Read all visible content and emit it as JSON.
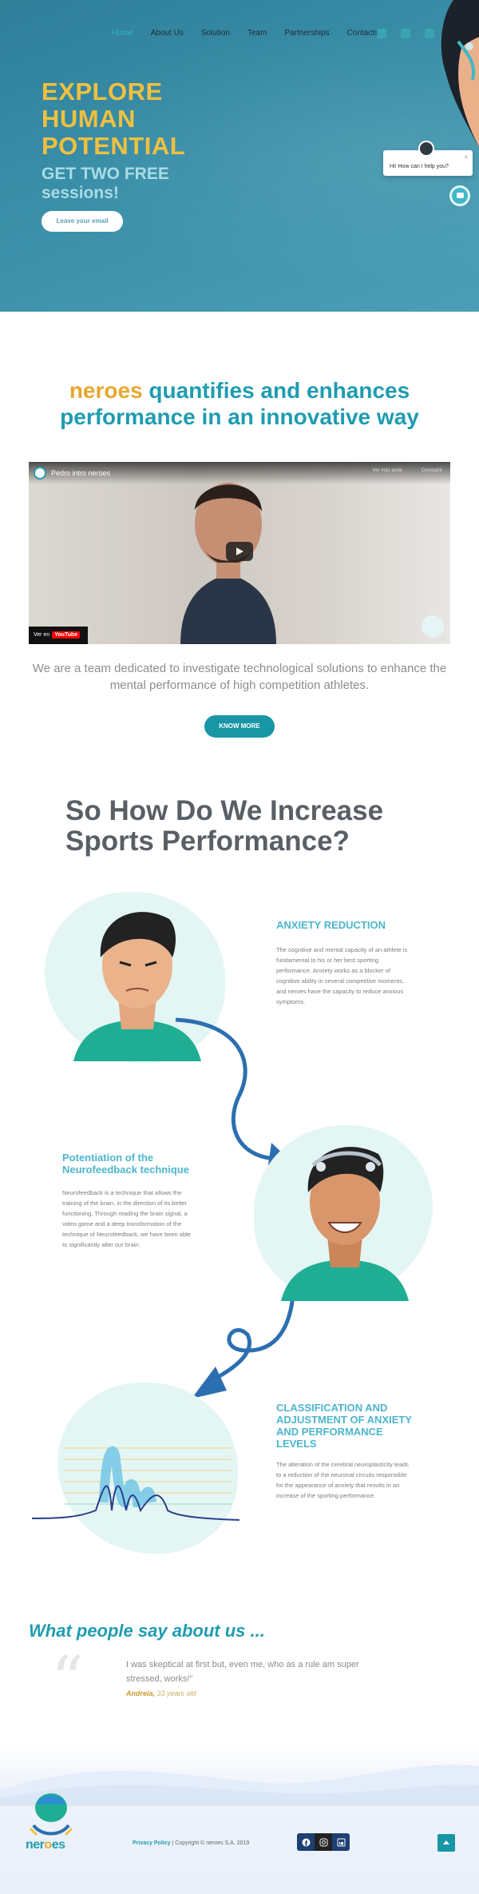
{
  "nav": {
    "items": [
      "Home",
      "About Us",
      "Solution",
      "Team",
      "Partnerships",
      "Contacts"
    ],
    "social_icons": [
      "facebook-icon",
      "instagram-icon",
      "linkedin-icon"
    ]
  },
  "hero": {
    "title": "EXPLORE HUMAN POTENTIAL",
    "subtitle": "GET TWO FREE sessions!",
    "email_button": "Leave your email"
  },
  "chat": {
    "greeting": "Hi! How can I help you?",
    "close": "×"
  },
  "intro": {
    "brand": "neroes",
    "headline_rest": " quantifies and enhances performance in an innovative way"
  },
  "video": {
    "title": "Pedro intro neroes",
    "watch_later": "Ver más tarde",
    "share": "Compartir",
    "watch_on": "Ver en",
    "youtube": "YouTube"
  },
  "team": {
    "text": "We are a team dedicated to investigate technological solutions to enhance the mental performance of high competition athletes.",
    "button": "KNOW MORE"
  },
  "how": {
    "title": "So How Do We Increase Sports Performance?",
    "features": [
      {
        "title": "ANXIETY REDUCTION",
        "body": "The cognitive and mental capacity of an athlete is fundamental to his or her best sporting performance. Anxiety works as a blocker of cognitive ability in several competitive moments, and neroes have the capacity to reduce anxious symptoms."
      },
      {
        "title": "Potentiation of the Neurofeedback technique",
        "body": "Neurofeedback is a technique that allows the training of the brain, in the direction of its better functioning. Through reading the brain signal, a video game and a deep transformation of the technique of Neurofeedback, we have been able to significantly alter our brain."
      },
      {
        "title": "CLASSIFICATION AND ADJUSTMENT OF ANXIETY AND PERFORMANCE LEVELS",
        "body": "The alteration of the cerebral neuroplasticity leads to a reduction of the neuronal circuits responsible for the appearance of anxiety that results in an increase of the sporting performance."
      }
    ]
  },
  "testimonials": {
    "title_start": "What people say ",
    "title_bold": "about us",
    "title_end": " ...",
    "quote": "I was skeptical at first but, even me, who as a rule am super stressed, works!\"",
    "author": "Andreia,",
    "age": " 33 years old"
  },
  "footer": {
    "logo_a": "ner",
    "logo_b": "o",
    "logo_c": "es",
    "privacy": "Privacy Policy",
    "copyright": " | Copyright © neroes S.A. 2019"
  },
  "colors": {
    "hero_bg": "#3a8fa8",
    "accent_yellow": "#f0c040",
    "accent_teal": "#1f9cb0",
    "feature_blue": "#4db5cd"
  }
}
